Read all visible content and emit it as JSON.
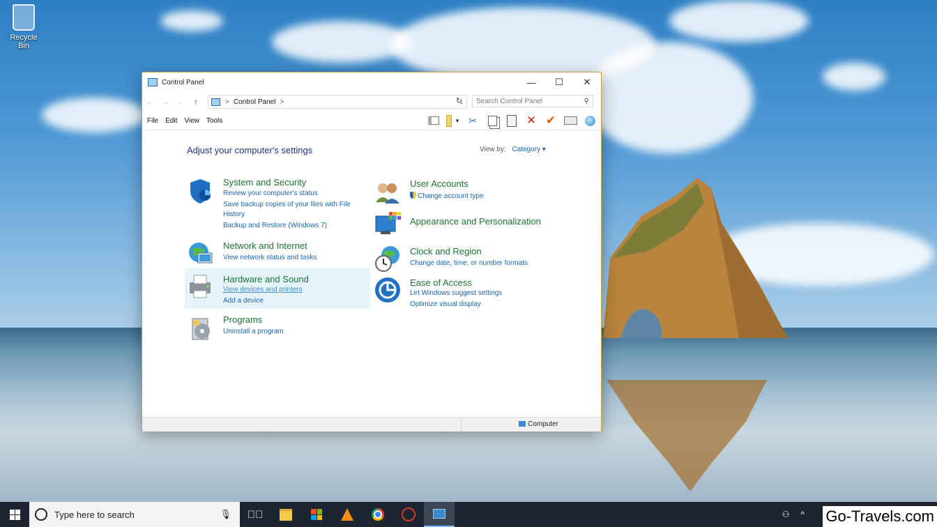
{
  "desktop": {
    "recycle_bin_label": "Recycle Bin"
  },
  "window": {
    "title": "Control Panel",
    "controls": {
      "minimize": "—",
      "maximize": "☐",
      "close": "✕"
    },
    "address": {
      "crumb": "Control Panel",
      "separator": ">",
      "trailing_separator": ">"
    },
    "search": {
      "placeholder": "Search Control Panel"
    },
    "menu": [
      "File",
      "Edit",
      "View",
      "Tools"
    ]
  },
  "content": {
    "heading": "Adjust your computer's settings",
    "view_by_label": "View by:",
    "view_by_value": "Category",
    "left": [
      {
        "title": "System and Security",
        "links": [
          "Review your computer's status",
          "Save backup copies of your files with File",
          "History",
          "Backup and Restore (Windows 7)"
        ]
      },
      {
        "title": "Network and Internet",
        "links": [
          "View network status and tasks"
        ]
      },
      {
        "title": "Hardware and Sound",
        "links": [
          "View devices and printers",
          "Add a device"
        ]
      },
      {
        "title": "Programs",
        "links": [
          "Uninstall a program"
        ]
      }
    ],
    "right": [
      {
        "title": "User Accounts",
        "links": [
          "Change account type"
        ]
      },
      {
        "title": "Appearance and Personalization",
        "links": []
      },
      {
        "title": "Clock and Region",
        "links": [
          "Change date, time, or number formats"
        ]
      },
      {
        "title": "Ease of Access",
        "links": [
          "Let Windows suggest settings",
          "Optimize visual display"
        ]
      }
    ]
  },
  "statusbar": {
    "location": "Computer"
  },
  "taskbar": {
    "search_text": "Type here to search"
  },
  "watermark": "Go-Travels.com"
}
